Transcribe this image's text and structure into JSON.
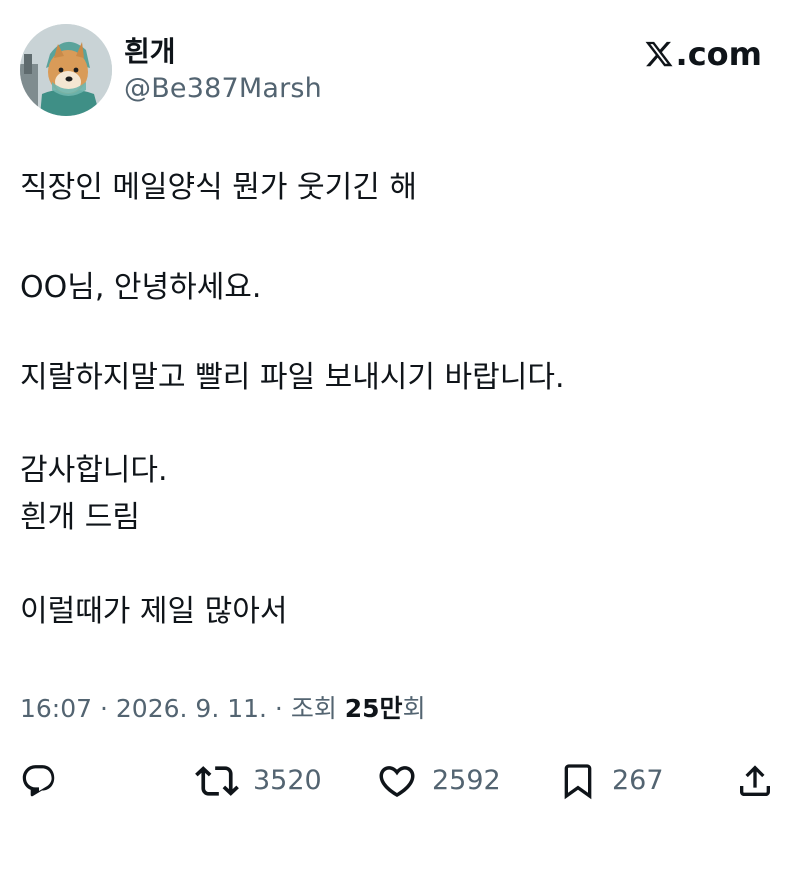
{
  "author": {
    "display_name": "흰개",
    "handle": "@Be387Marsh"
  },
  "source": {
    "logo_text": ".com",
    "icon": "x-logo-icon"
  },
  "tweet": {
    "lines": [
      "직장인 메일양식 뭔가 웃기긴 해",
      "OO님, 안녕하세요.",
      "지랄하지말고 빨리 파일 보내시기 바랍니다.",
      "감사합니다.",
      "흰개 드림",
      "이럴때가 제일 많아서"
    ]
  },
  "meta": {
    "time": "16:07",
    "separator": " · ",
    "date": "2026. 9. 11.",
    "views_label": "조회 ",
    "views_count": "25만",
    "views_unit": "회"
  },
  "actions": {
    "reply": {
      "icon": "reply-icon",
      "count": ""
    },
    "retweet": {
      "icon": "retweet-icon",
      "count": "3520"
    },
    "like": {
      "icon": "heart-icon",
      "count": "2592"
    },
    "bookmark": {
      "icon": "bookmark-icon",
      "count": "267"
    },
    "share": {
      "icon": "share-icon",
      "count": ""
    }
  },
  "colors": {
    "text_primary": "#0f1419",
    "text_secondary": "#536471",
    "background": "#ffffff"
  }
}
